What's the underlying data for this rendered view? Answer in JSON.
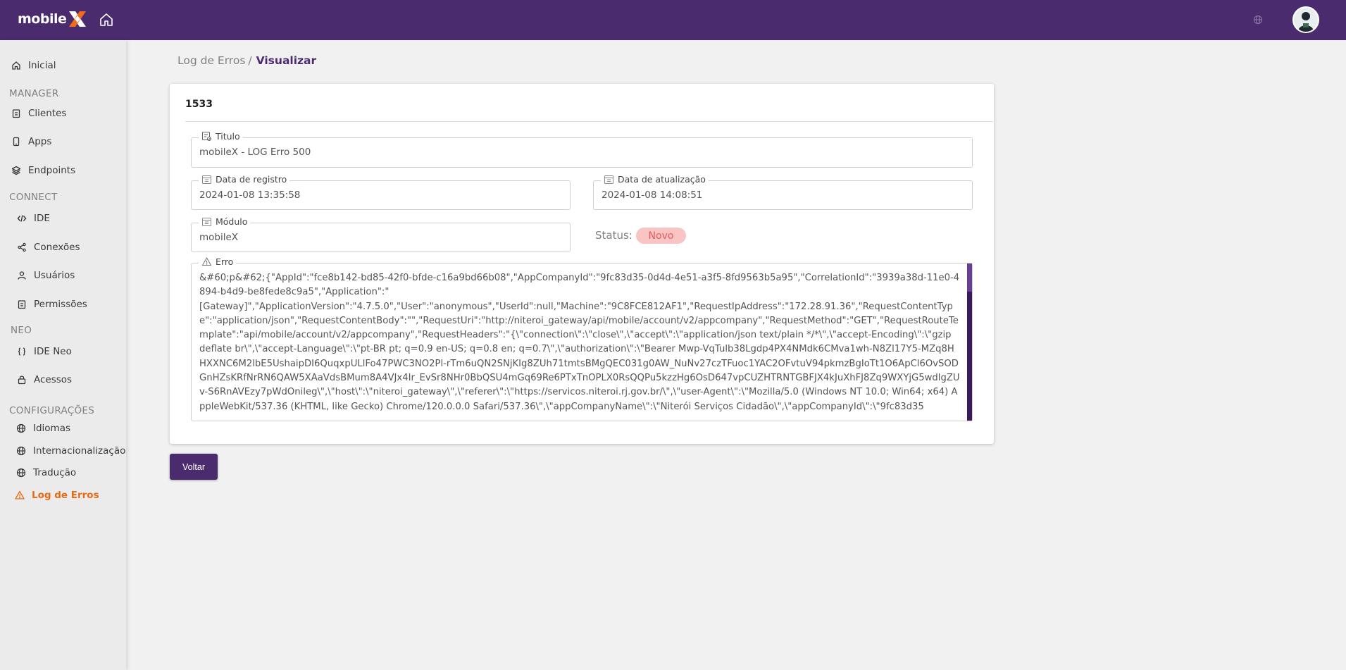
{
  "app": {
    "brand": "mobile",
    "brand_mark": "X",
    "accent_color": "#4a2c6e",
    "highlight_color": "#e96a16"
  },
  "sidebar": {
    "items": [
      {
        "label": "Inicial",
        "icon": "home-icon"
      },
      {
        "section": "MANAGER"
      },
      {
        "label": "Clientes",
        "icon": "clipboard-icon"
      },
      {
        "label": "Apps",
        "icon": "phone-icon"
      },
      {
        "label": "Endpoints",
        "icon": "layers-icon"
      },
      {
        "section": "CONNECT"
      },
      {
        "label": "IDE",
        "icon": "code-icon"
      },
      {
        "label": "Conexões",
        "icon": "share-icon"
      },
      {
        "label": "Usuários",
        "icon": "user-icon"
      },
      {
        "label": "Permissões",
        "icon": "clipboard-icon"
      },
      {
        "section": "NEO"
      },
      {
        "label": "IDE Neo",
        "icon": "braces-icon"
      },
      {
        "label": "Acessos",
        "icon": "lock-icon"
      },
      {
        "section": "CONFIGURAÇÕES"
      },
      {
        "label": "Idiomas",
        "icon": "globe-icon"
      },
      {
        "label": "Internacionalização",
        "icon": "globe-icon"
      },
      {
        "label": "Tradução",
        "icon": "globe-icon"
      },
      {
        "label": "Log de Erros",
        "icon": "warning-icon",
        "active": true
      }
    ]
  },
  "breadcrumb": {
    "parent": "Log de Erros",
    "separator": "/",
    "current": "Visualizar"
  },
  "record": {
    "id": "1533",
    "titulo_label": "Titulo",
    "titulo_value": "mobileX - LOG Erro 500",
    "data_registro_label": "Data de registro",
    "data_registro_value": "2024-01-08 13:35:58",
    "data_atualizacao_label": "Data de atualização",
    "data_atualizacao_value": "2024-01-08 14:08:51",
    "modulo_label": "Módulo",
    "modulo_value": "mobileX",
    "status_label": "Status:",
    "status_value": "Novo",
    "erro_label": "Erro",
    "erro_value": "&#60;p&#62;{\"AppId\":\"fce8b142-bd85-42f0-bfde-c16a9bd66b08\",\"AppCompanyId\":\"9fc83d35-0d4d-4e51-a3f5-8fd9563b5a95\",\"CorrelationId\":\"3939a38d-11e0-4894-b4d9-be8fede8c9a5\",\"Application\":\"\n[Gateway]\",\"ApplicationVersion\":\"4.7.5.0\",\"User\":\"anonymous\",\"UserId\":null,\"Machine\":\"9C8FCE812AF1\",\"RequestIpAddress\":\"172.28.91.36\",\"RequestContentType\":\"application/json\",\"RequestContentBody\":\"\",\"RequestUri\":\"http://niteroi_gateway/api/mobile/account/v2/appcompany\",\"RequestMethod\":\"GET\",\"RequestRouteTemplate\":\"api/mobile/account/v2/appcompany\",\"RequestHeaders\":\"{\\\"connection\\\":\\\"close\\\",\\\"accept\\\":\\\"application/json text/plain */*\\\",\\\"accept-Encoding\\\":\\\"gzip deflate br\\\",\\\"accept-Language\\\":\\\"pt-BR pt; q=0.9 en-US; q=0.8 en; q=0.7\\\",\\\"authorization\\\":\\\"Bearer Mwp-VqTulb38Lgdp4PX4NMdk6CMva1wh-N8Zl17Y5-MZq8HHXXNC6M2lbE5UshaipDI6QuqxpULlFo47PWC3NO2Pl-rTm6uQN2SNjKIg8ZUh71tmtsBMgQEC031g0AW_NuNv27czTFuoc1YAC2OFvtuV94pkmzBgIoTt1O6ApCl6OvSODGnHZsKRfNrRN6QAW5XAaVdsBMum8A4VJx4Ir_EvSr8NHr0BbQSU4mGq69Re6PTxTnOPLX0RsQQPu5kzzHg6OsD647vpCUZHTRNTGBFJX4kJuXhFJ8Zq9WXYjG5wdlgZUv-S6RnAVEzy7pWdOnileg\\\",\\\"host\\\":\\\"niteroi_gateway\\\",\\\"referer\\\":\\\"https://servicos.niteroi.rj.gov.br/\\\",\\\"user-Agent\\\":\\\"Mozilla/5.0 (Windows NT 10.0; Win64; x64) AppleWebKit/537.36 (KHTML, like Gecko) Chrome/120.0.0.0 Safari/537.36\\\",\\\"appCompanyName\\\":\\\"Niterói Serviços Cidadão\\\",\\\"appCompanyId\\\":\\\"9fc83d35"
  },
  "actions": {
    "back_label": "Voltar"
  }
}
